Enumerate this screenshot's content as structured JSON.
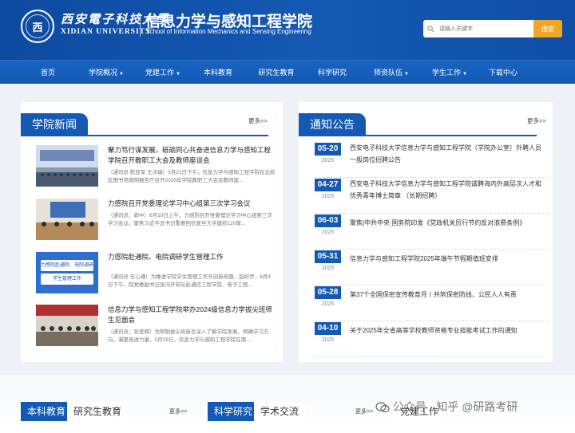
{
  "header": {
    "logo_cn": "西安電子科技大學",
    "logo_en": "XIDIAN UNIVERSITY",
    "school_cn": "信息力学与感知工程学院",
    "school_en": "School of Information Mechanics and Sensing Engineering",
    "search_placeholder": "请输入关键字",
    "search_button": "搜索"
  },
  "nav": [
    {
      "label": "首页",
      "dropdown": false
    },
    {
      "label": "学院概况",
      "dropdown": true
    },
    {
      "label": "党建工作",
      "dropdown": true
    },
    {
      "label": "本科教育",
      "dropdown": false
    },
    {
      "label": "研究生教育",
      "dropdown": false
    },
    {
      "label": "科学研究",
      "dropdown": false
    },
    {
      "label": "师资队伍",
      "dropdown": true
    },
    {
      "label": "学生工作",
      "dropdown": true
    },
    {
      "label": "下载中心",
      "dropdown": false
    }
  ],
  "news": {
    "title": "学院新闻",
    "more": "更多>>",
    "items": [
      {
        "title": "聚力笃行谋发展，砥砺同心共奋进信息力学与感知工程学院召开教职工大会及教师座谈会",
        "summary": "（通讯员 陈亚军 王冷瑞）5月21日下午，信息力学与感知工程学院在北校区图书馆南侧报告厅召开2025年学院教职工大会及教师座..."
      },
      {
        "title": "力感院召开党委理论学习中心组第三次学习会议",
        "summary": "（通讯员：郭中）6月10日上午，力感院召开党委理论学习中心组第三次学习会议。聚焦习近平总书记重要回信复旦大学建校120周..."
      },
      {
        "title": "力感院赴通院、电院调研学生管理工作",
        "summary": "（通讯员 任心瑾）为推进学院学生管理工作开创新局面，起好步，6月4日下午，院党委副书记张冯开带队赴通信工程学院、电子工程..."
      },
      {
        "title": "信息力学与感知工程学院举办2024级信息力学拔尖班师生见面会",
        "summary": "（通讯员：张爱辉）为帮助拔尖班新生深入了解学院发展，明确学习方向，凝聚奋进力量，5月29日，信息力学与感知工程学院在南..."
      }
    ],
    "thumb3_text": [
      "力感院赴通院、电院调研",
      "学生管理工作"
    ]
  },
  "notices": {
    "title": "通知公告",
    "more": "更多>>",
    "items": [
      {
        "md": "05-20",
        "year": "2025",
        "title": "西安电子科技大学信息力学与感知工程学院（学院办公室）外聘人员一般岗位招聘公告"
      },
      {
        "md": "04-27",
        "year": "2025",
        "title": "西安电子科技大学信息力学与感知工程学院诚聘海内外高层次人才和优秀青年博士简章 （长期招聘）"
      },
      {
        "md": "06-03",
        "year": "2025",
        "title": "聚焦|中共中央 国务院印发《党政机关厉行节约反对浪费条例》"
      },
      {
        "md": "05-31",
        "year": "2025",
        "title": "信息力学与感知工程学院2025年端午节假期值班安排"
      },
      {
        "md": "05-28",
        "year": "2025",
        "title": "第37个全国保密宣传教育月丨共筑保密防线、公民人人有责"
      },
      {
        "md": "04-10",
        "year": "2025",
        "title": "关于2025年全省高等学校教师资格专业技能考试工作的通知"
      }
    ]
  },
  "bottom": {
    "tab1_active": "本科教育",
    "tab1_inactive": "研究生教育",
    "more1": "更多>>",
    "tab2_active": "科学研究",
    "tab2_inactive": "学术交流",
    "more2": "更多>>",
    "tab3": "党建工作",
    "watermark": "公众号 · 知乎 @研路考研"
  },
  "colors": {
    "primary": "#1459b3",
    "accent": "#f2a626"
  }
}
